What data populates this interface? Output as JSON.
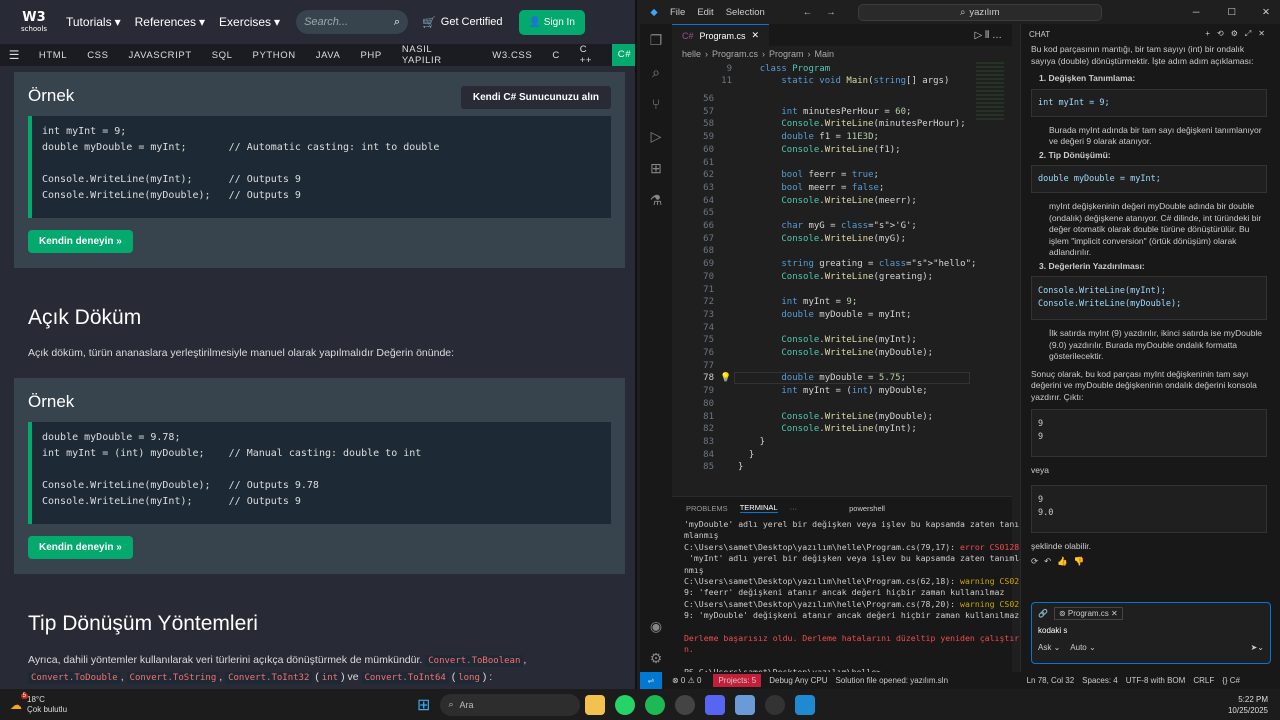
{
  "w3": {
    "logo": "W3",
    "logo_sub": "schools",
    "nav": [
      "Tutorials",
      "References",
      "Exercises"
    ],
    "search_placeholder": "Search...",
    "cert": "Get Certified",
    "signin": "Sign In",
    "subnav": [
      "HTML",
      "CSS",
      "JAVASCRIPT",
      "SQL",
      "PYTHON",
      "JAVA",
      "PHP",
      "NASIL YAPILIR",
      "W3.CSS",
      "C",
      "C ++",
      "C#"
    ],
    "example1_title": "Örnek",
    "server_btn": "Kendi C# Sunucunuzu alın",
    "code1": [
      "int myInt = 9;",
      "double myDouble = myInt;       // Automatic casting: int to double",
      "",
      "Console.WriteLine(myInt);      // Outputs 9",
      "Console.WriteLine(myDouble);   // Outputs 9"
    ],
    "try_btn": "Kendin deneyin »",
    "heading2": "Açık Döküm",
    "para2": "Açık döküm, türün ananaslara yerleştirilmesiyle manuel olarak yapılmalıdır Değerin önünde:",
    "example2_title": "Örnek",
    "code2": [
      "double myDouble = 9.78;",
      "int myInt = (int) myDouble;    // Manual casting: double to int",
      "",
      "Console.WriteLine(myDouble);   // Outputs 9.78",
      "Console.WriteLine(myInt);      // Outputs 9"
    ],
    "heading3": "Tip Dönüşüm Yöntemleri",
    "para3": "Ayrıca, dahili yöntemler kullanılarak veri türlerini açıkça dönüştürmek de mümkündür.",
    "methods": [
      "Convert.ToBoolean",
      "Convert.ToDouble",
      "Convert.ToString",
      "Convert.ToInt32",
      "int",
      "Convert.ToInt64",
      "long"
    ],
    "methods_and": "ve"
  },
  "vs": {
    "menu": [
      "File",
      "Edit",
      "Selection"
    ],
    "search": "yazılım",
    "tab": "Program.cs",
    "breadcrumb": [
      "helle",
      "Program.cs",
      "Program",
      "Main"
    ],
    "sticky": [
      [
        "9",
        "    class Program"
      ],
      [
        "11",
        "        static void Main(string[] args)"
      ]
    ],
    "lines": [
      [
        "56",
        ""
      ],
      [
        "57",
        "        int minutesPerHour = 60;"
      ],
      [
        "58",
        "        Console.WriteLine(minutesPerHour);"
      ],
      [
        "59",
        "        double f1 = 11E3D;"
      ],
      [
        "60",
        "        Console.WriteLine(f1);"
      ],
      [
        "61",
        ""
      ],
      [
        "62",
        "        bool feerr = true;"
      ],
      [
        "63",
        "        bool meerr = false;"
      ],
      [
        "64",
        "        Console.WriteLine(meerr);"
      ],
      [
        "65",
        ""
      ],
      [
        "66",
        "        char myG = 'G';"
      ],
      [
        "67",
        "        Console.WriteLine(myG);"
      ],
      [
        "68",
        ""
      ],
      [
        "69",
        "        string greating = \"hello\";"
      ],
      [
        "70",
        "        Console.WriteLine(greating);"
      ],
      [
        "71",
        ""
      ],
      [
        "72",
        "        int myInt = 9;"
      ],
      [
        "73",
        "        double myDouble = myInt;"
      ],
      [
        "74",
        ""
      ],
      [
        "75",
        "        Console.WriteLine(myInt);"
      ],
      [
        "76",
        "        Console.WriteLine(myDouble);"
      ],
      [
        "77",
        ""
      ],
      [
        "78",
        "        double myDouble = 5.75;"
      ],
      [
        "79",
        "        int myInt = (int) myDouble;"
      ],
      [
        "80",
        ""
      ],
      [
        "81",
        "        Console.WriteLine(myDouble);"
      ],
      [
        "82",
        "        Console.WriteLine(myInt);"
      ],
      [
        "83",
        "    }"
      ],
      [
        "84",
        "  }"
      ],
      [
        "85",
        "}"
      ]
    ],
    "panel_tabs": [
      "PROBLEMS",
      "TERMINAL",
      "powershell"
    ],
    "terminal": [
      "'myDouble' adlı yerel bir değişken veya işlev bu kapsamda zaten tanı",
      "mlanmış",
      "C:\\Users\\samet\\Desktop\\yazılım\\helle\\Program.cs(79,17): error CS0128:",
      " 'myInt' adlı yerel bir değişken veya işlev bu kapsamda zaten tanımla",
      "nmış",
      "C:\\Users\\samet\\Desktop\\yazılım\\helle\\Program.cs(62,18): warning CS021",
      "9: 'feerr' değişkeni atanır ancak değeri hiçbir zaman kullanılmaz",
      "C:\\Users\\samet\\Desktop\\yazılım\\helle\\Program.cs(78,20): warning CS021",
      "9: 'myDouble' değişkeni atanır ancak değeri hiçbir zaman kullanılmaz",
      "",
      "Derleme başarısız oldu. Derleme hatalarını düzeltip yeniden çalıştırı",
      "n.",
      "",
      "PS C:\\Users\\samet\\Desktop\\yazılım\\helle> "
    ],
    "chat_title": "CHAT",
    "chat_intro": "Bu kod parçasının mantığı, bir tam sayıyı (int) bir ondalık sayıya (double) dönüştürmektir. İşte adım adım açıklaması:",
    "s1": "1. Değişken Tanımlama:",
    "c1": "int myInt = 9;",
    "p1": "Burada myInt adında bir tam sayı değişkeni tanımlanıyor ve değeri 9 olarak atanıyor.",
    "s2": "2. Tip Dönüşümü:",
    "c2": "double myDouble = myInt;",
    "p2": "myInt değişkeninin değeri myDouble adında bir double (ondalık) değişkene atanıyor. C# dilinde, int türündeki bir değer otomatik olarak double türüne dönüştürülür. Bu işlem \"implicit conversion\" (örtük dönüşüm) olarak adlandırılır.",
    "s3": "3. Değerlerin Yazdırılması:",
    "c3a": "Console.WriteLine(myInt);",
    "c3b": "Console.WriteLine(myDouble);",
    "p3": "İlk satırda myInt (9) yazdırılır, ikinci satırda ise myDouble (9.0) yazdırılır. Burada myDouble ondalık formatta gösterilecektir.",
    "p4": "Sonuç olarak, bu kod parçası myInt değişkeninin tam sayı değerini ve myDouble değişkeninin ondalık değerini konsola yazdırır. Çıktı:",
    "o1a": "9",
    "o1b": "9",
    "veya": "veya",
    "o2a": "9",
    "o2b": "9.0",
    "p5": "şeklinde olabilir.",
    "input_file": "Program.cs",
    "input_text": "kodaki s",
    "ask": "Ask",
    "auto": "Auto",
    "status": [
      "Projects: 5",
      "Debug Any CPU",
      "Solution file opened: yazılım.sln",
      "Ln 78, Col 32",
      "Spaces: 4",
      "UTF-8 with BOM",
      "CRLF",
      "{} C#"
    ]
  },
  "task": {
    "temp": "18°C",
    "weather": "Çok bulutlu",
    "search": "Ara",
    "time": "5:22 PM",
    "date": "10/25/2025",
    "badge": "5"
  }
}
